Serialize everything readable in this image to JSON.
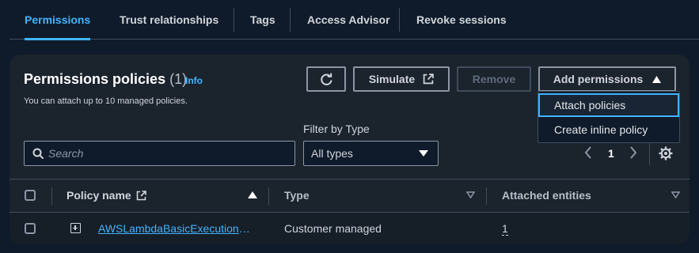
{
  "tabs": [
    {
      "label": "Permissions",
      "active": true
    },
    {
      "label": "Trust relationships"
    },
    {
      "label": "Tags"
    },
    {
      "label": "Access Advisor"
    },
    {
      "label": "Revoke sessions"
    }
  ],
  "panel": {
    "title": "Permissions policies",
    "count": "(1)",
    "info": "Info",
    "subtitle": "You can attach up to 10 managed policies."
  },
  "toolbar": {
    "refresh_icon": "refresh-icon",
    "simulate_label": "Simulate",
    "remove_label": "Remove",
    "add_permissions_label": "Add permissions"
  },
  "add_menu": {
    "items": [
      {
        "label": "Attach policies",
        "focused": true
      },
      {
        "label": "Create inline policy"
      }
    ]
  },
  "filter": {
    "label": "Filter by Type",
    "search_placeholder": "Search",
    "type_value": "All types"
  },
  "pagination": {
    "page": "1"
  },
  "table": {
    "columns": [
      "Policy name",
      "Type",
      "Attached entities"
    ],
    "rows": [
      {
        "policy_name": "AWSLambdaBasicExecutionRole",
        "type": "Customer managed",
        "attached_entities": "1"
      }
    ]
  },
  "colors": {
    "accent": "#42b4ff",
    "background": "#0f1b2a",
    "panel": "#1b232d"
  }
}
